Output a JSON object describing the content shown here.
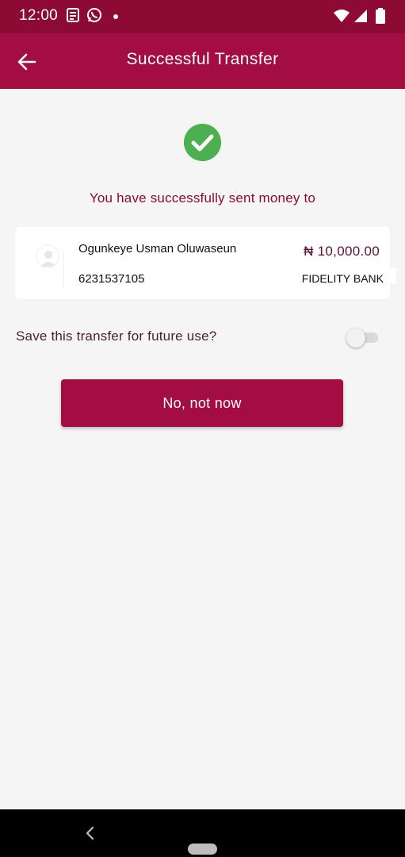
{
  "status_bar": {
    "time": "12:00",
    "icons": [
      "news-icon",
      "whatsapp-icon",
      "notification-dot",
      "wifi-icon",
      "signal-icon",
      "battery-icon"
    ]
  },
  "app_bar": {
    "title": "Successful Transfer",
    "back_icon": "arrow-back-icon"
  },
  "success": {
    "icon": "check-circle-icon",
    "message": "You have successfully sent money to"
  },
  "recipient": {
    "name": "Ogunkeye Usman Oluwaseun",
    "account_number": "6231537105",
    "amount": "₦ 10,000.00",
    "bank": "FIDELITY BANK",
    "avatar_icon": "user-avatar-icon"
  },
  "save_transfer": {
    "label": "Save this transfer for future use?",
    "enabled": false
  },
  "actions": {
    "not_now_label": "No, not now"
  },
  "colors": {
    "status_bar": "#8c0a34",
    "primary": "#a30d42",
    "success": "#4caf50",
    "background": "#f5f5f5"
  }
}
